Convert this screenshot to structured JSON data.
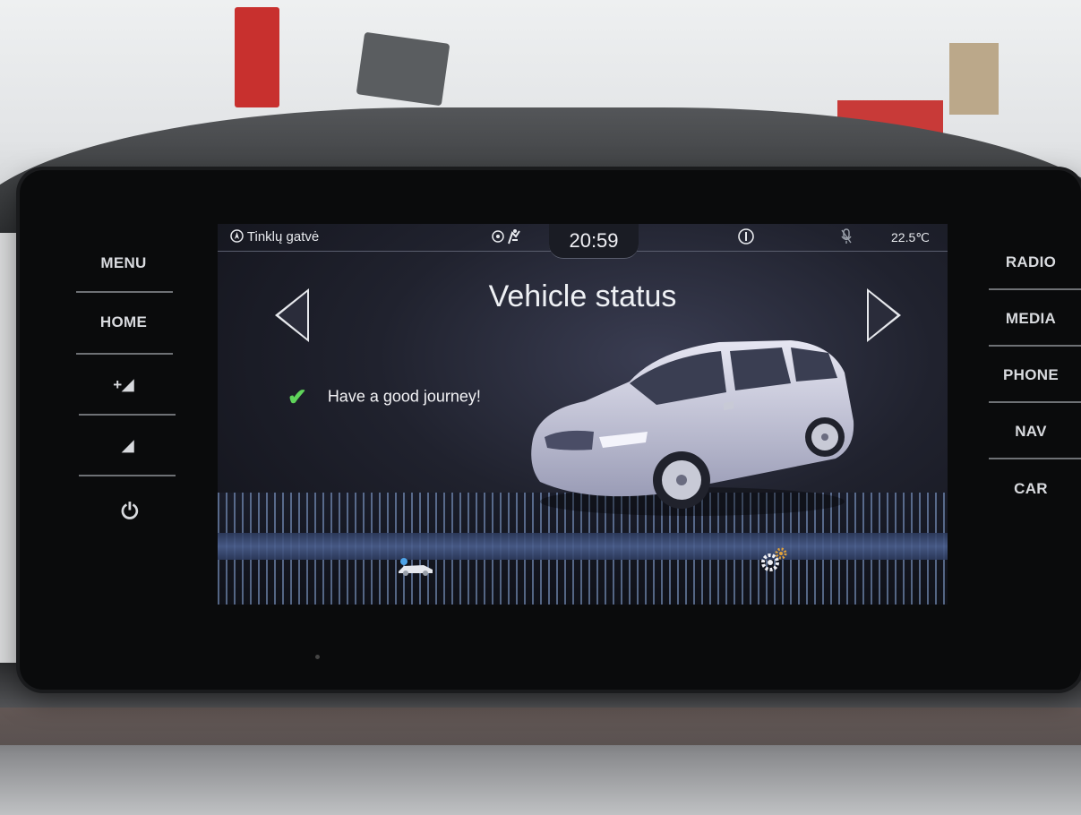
{
  "left_buttons": [
    "MENU",
    "HOME",
    "+◢",
    "◢",
    "⏻"
  ],
  "right_buttons": [
    "RADIO",
    "MEDIA",
    "PHONE",
    "NAV",
    "CAR"
  ],
  "status_bar": {
    "location": "Tinklų gatvė",
    "time": "20:59",
    "temperature": "22.5℃"
  },
  "screen": {
    "title": "Vehicle status",
    "message": "Have a good journey!"
  },
  "icons": {
    "status_left": "compass-icon",
    "status_mid": "traffic-sign-icon",
    "info": "info-icon",
    "mic": "microphone-off-icon",
    "check": "checkmark-icon",
    "car_tab": "car-icon",
    "settings_tab": "gears-icon"
  },
  "colors": {
    "check": "#5fd35a",
    "floor_grid": "#8caadc"
  }
}
